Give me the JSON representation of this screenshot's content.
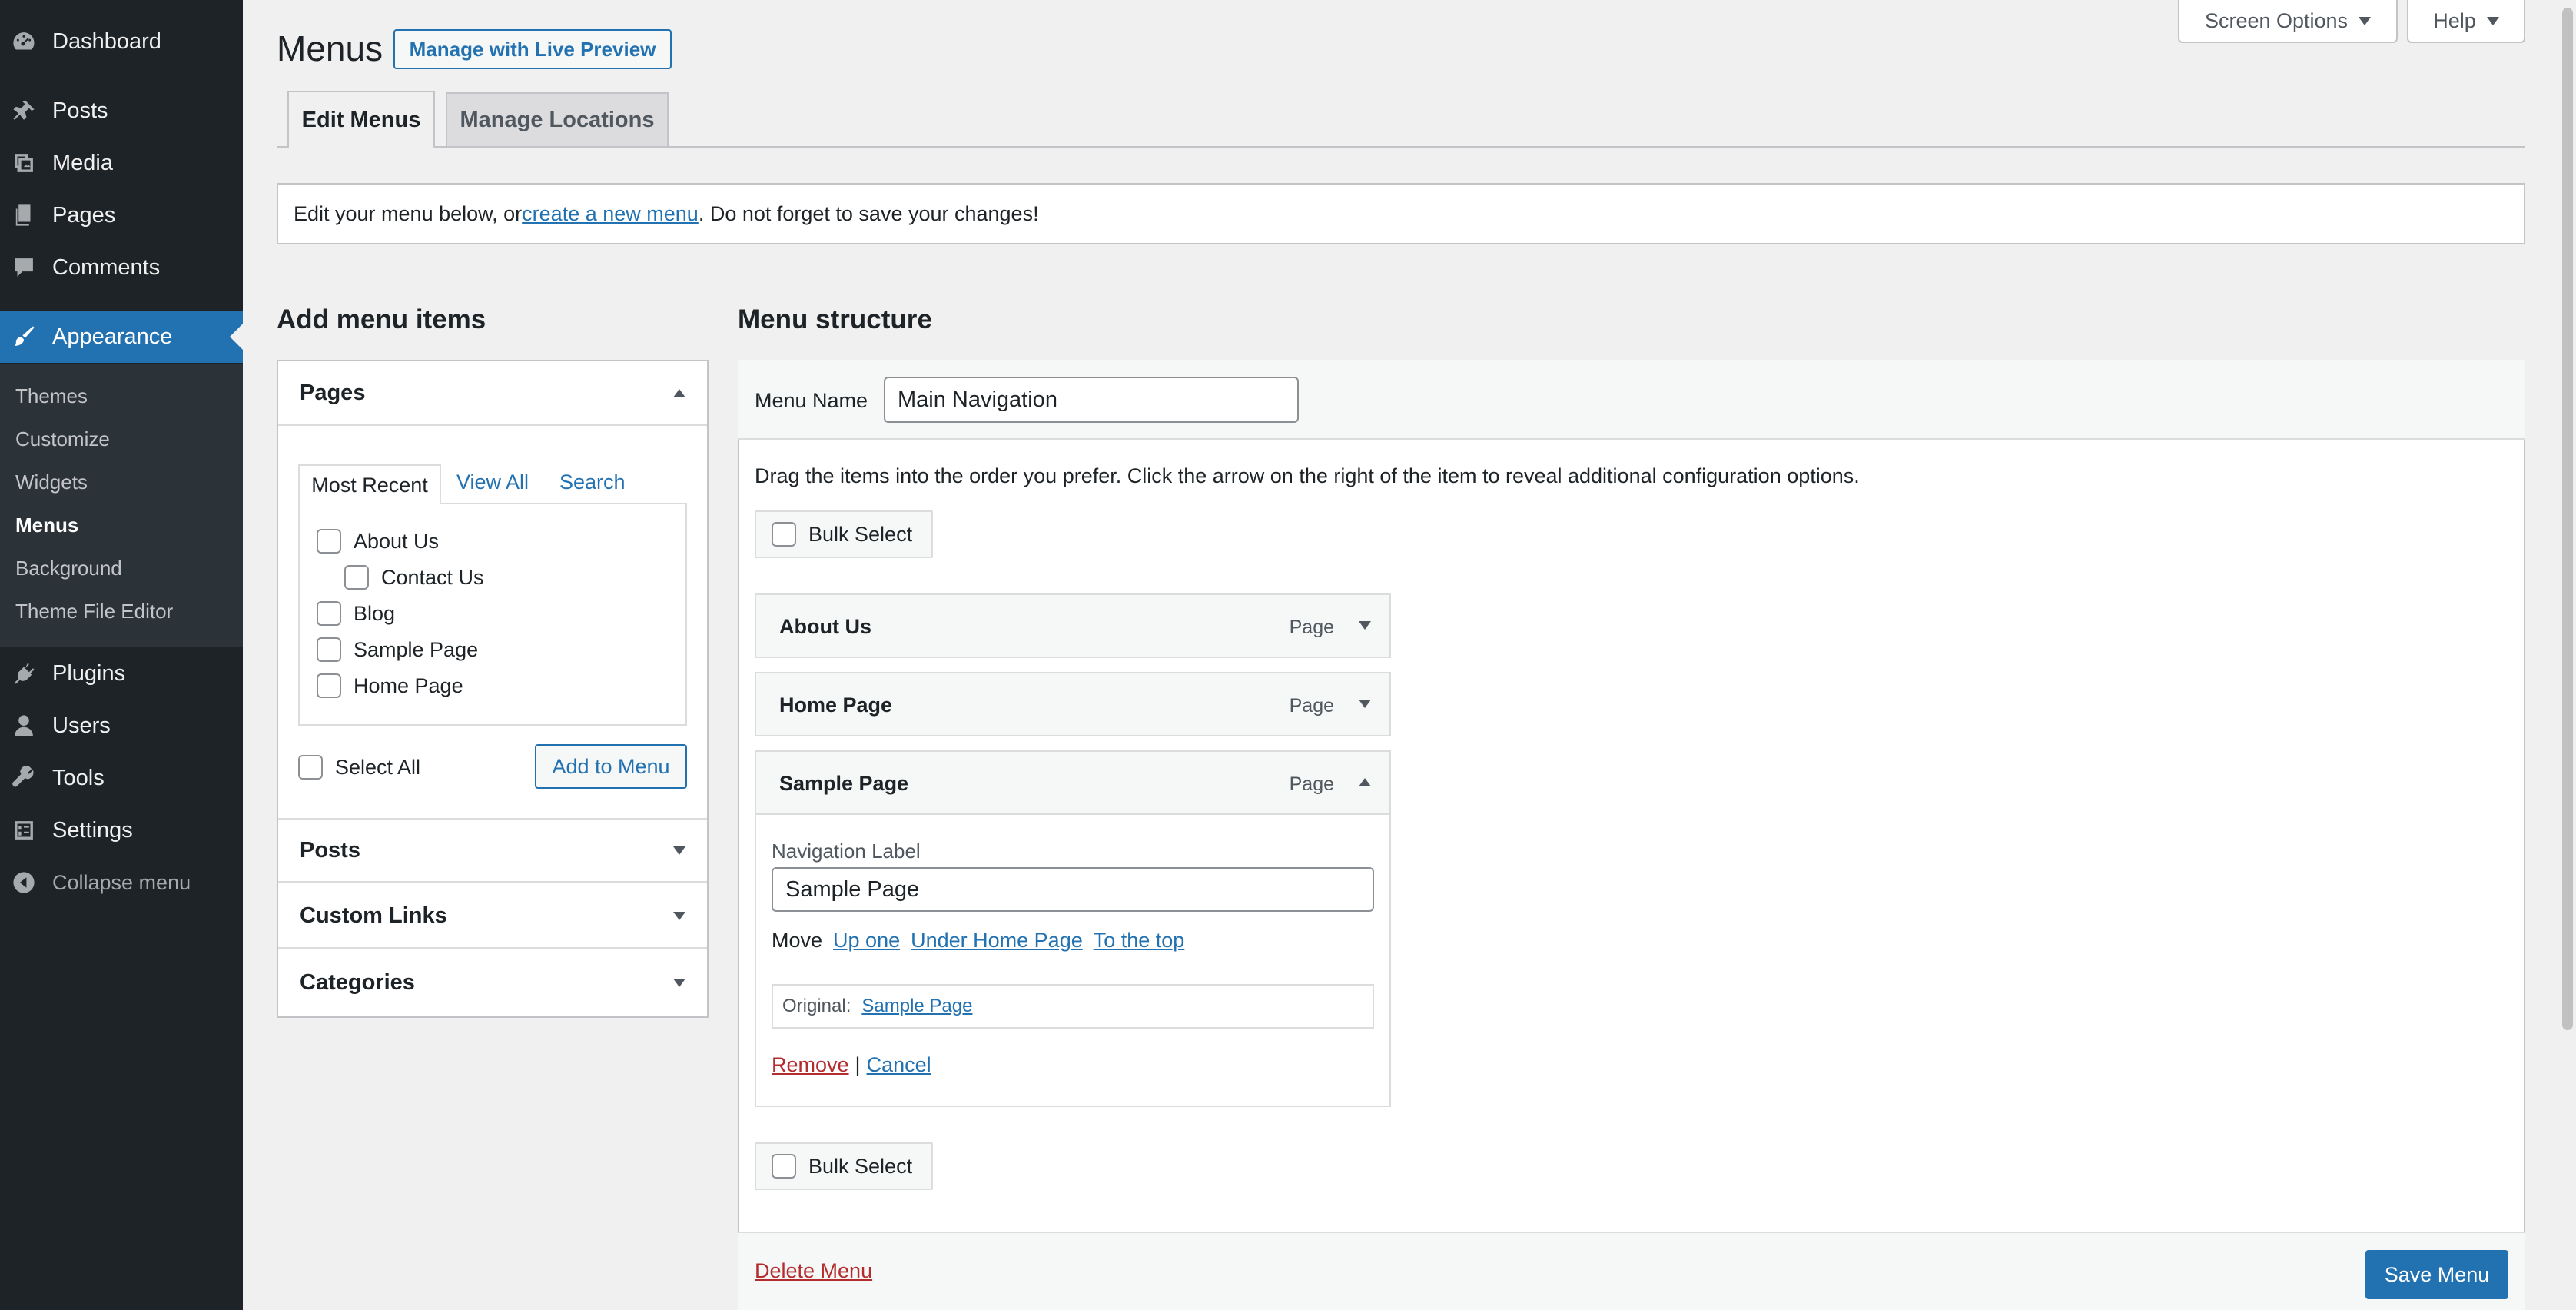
{
  "sidebar": {
    "dashboard": "Dashboard",
    "posts": "Posts",
    "media": "Media",
    "pages": "Pages",
    "comments": "Comments",
    "appearance": "Appearance",
    "submenu": [
      "Themes",
      "Customize",
      "Widgets",
      "Menus",
      "Background",
      "Theme File Editor"
    ],
    "plugins": "Plugins",
    "users": "Users",
    "tools": "Tools",
    "settings": "Settings",
    "collapse": "Collapse menu"
  },
  "top_buttons": {
    "screen_options": "Screen Options",
    "help": "Help"
  },
  "header": {
    "title": "Menus",
    "live_preview": "Manage with Live Preview"
  },
  "tabs": {
    "edit": "Edit Menus",
    "locations": "Manage Locations"
  },
  "notice": {
    "before": "Edit your menu below, or ",
    "link": "create a new menu",
    "after": ". Do not forget to save your changes!"
  },
  "add_items": {
    "heading": "Add menu items",
    "pages_title": "Pages",
    "inner_tabs": {
      "recent": "Most Recent",
      "all": "View All",
      "search": "Search"
    },
    "pages": [
      "About Us",
      "Contact Us",
      "Blog",
      "Sample Page",
      "Home Page"
    ],
    "select_all": "Select All",
    "add_button": "Add to Menu",
    "sections": [
      "Posts",
      "Custom Links",
      "Categories"
    ]
  },
  "structure": {
    "heading": "Menu structure",
    "menu_name_label": "Menu Name",
    "menu_name_value": "Main Navigation",
    "instructions": "Drag the items into the order you prefer. Click the arrow on the right of the item to reveal additional configuration options.",
    "bulk_select": "Bulk Select",
    "items": [
      {
        "title": "About Us",
        "type": "Page"
      },
      {
        "title": "Home Page",
        "type": "Page"
      },
      {
        "title": "Sample Page",
        "type": "Page"
      }
    ],
    "settings": {
      "nav_label": "Navigation Label",
      "nav_value": "Sample Page",
      "move_label": "Move",
      "move_up": "Up one",
      "move_under": "Under Home Page",
      "move_top": "To the top",
      "original_label": "Original:",
      "original_link": "Sample Page",
      "remove": "Remove",
      "separator": "|",
      "cancel": "Cancel"
    },
    "delete_menu": "Delete Menu",
    "save_menu": "Save Menu"
  }
}
